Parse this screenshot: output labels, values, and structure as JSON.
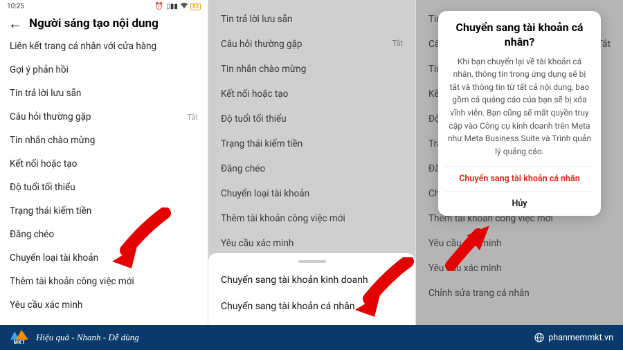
{
  "status": {
    "time": "10:25",
    "clock_icon": "⏰",
    "signal_icon": "▯▮▮",
    "battery": "83"
  },
  "panel1": {
    "title": "Người sáng tạo nội dung",
    "items": [
      {
        "label": "Liên kết trang cá nhân với cửa hàng",
        "badge": ""
      },
      {
        "label": "Gợi ý phản hồi",
        "badge": ""
      },
      {
        "label": "Tin trả lời lưu sẵn",
        "badge": ""
      },
      {
        "label": "Câu hỏi thường gặp",
        "badge": "Tắt"
      },
      {
        "label": "Tin nhắn chào mừng",
        "badge": ""
      },
      {
        "label": "Kết nối hoặc tạo",
        "badge": ""
      },
      {
        "label": "Độ tuổi tối thiểu",
        "badge": ""
      },
      {
        "label": "Trạng thái kiếm tiền",
        "badge": ""
      },
      {
        "label": "Đăng chéo",
        "badge": ""
      },
      {
        "label": "Chuyển loại tài khoản",
        "badge": ""
      },
      {
        "label": "Thêm tài khoản công việc mới",
        "badge": ""
      },
      {
        "label": "Yêu cầu xác minh",
        "badge": ""
      }
    ]
  },
  "panel2": {
    "items": [
      {
        "label": "Tin trả lời lưu sẵn",
        "badge": ""
      },
      {
        "label": "Câu hỏi thường gặp",
        "badge": "Tắt"
      },
      {
        "label": "Tin nhắn chào mừng",
        "badge": ""
      },
      {
        "label": "Kết nối hoặc tạo",
        "badge": ""
      },
      {
        "label": "Độ tuổi tối thiểu",
        "badge": ""
      },
      {
        "label": "Trạng thái kiếm tiền",
        "badge": ""
      },
      {
        "label": "Đăng chéo",
        "badge": ""
      },
      {
        "label": "Chuyển loại tài khoản",
        "badge": ""
      },
      {
        "label": "Thêm tài khoản công việc mới",
        "badge": ""
      },
      {
        "label": "Yêu cầu xác minh",
        "badge": ""
      }
    ],
    "sheet": {
      "options": [
        "Chuyển sang tài khoản kinh doanh",
        "Chuyển sang tài khoản cá nhân"
      ]
    }
  },
  "panel3": {
    "items": [
      {
        "label": "Tin trả lời lưu sẵn",
        "badge": ""
      },
      {
        "label": "Câu hỏi thường gặp",
        "badge": "Tắt"
      },
      {
        "label": "Tin nhắn chào mừng",
        "badge": ""
      },
      {
        "label": "Kết nối hoặc tạo",
        "badge": ""
      },
      {
        "label": "Độ tuổi tối thiểu",
        "badge": ""
      },
      {
        "label": "Trạng thái kiếm tiền",
        "badge": ""
      },
      {
        "label": "Đăng chéo",
        "badge": ""
      },
      {
        "label": "Chuyển loại tài khoản",
        "badge": ""
      },
      {
        "label": "Thêm tài khoản công việc mới",
        "badge": ""
      },
      {
        "label": "Yêu cầu xác minh",
        "badge": ""
      },
      {
        "label": "Yêu cầu xác minh",
        "badge": ""
      },
      {
        "label": "Chỉnh sửa trang cá nhân",
        "badge": ""
      }
    ],
    "dialog": {
      "title": "Chuyển sang tài khoản cá nhân?",
      "body": "Khi bạn chuyển lại về tài khoản cá nhân, thông tin trong ứng dụng sẽ bị tắt và thông tin từ tất cả nội dung, bao gồm cả quảng cáo của bạn sẽ bị xóa vĩnh viễn. Bạn cũng sẽ mất quyền truy cập vào Công cụ kinh doanh trên Meta như Meta Business Suite và Trình quản lý quảng cáo.",
      "confirm": "Chuyển sang tài khoản cá nhân",
      "cancel": "Hủy"
    }
  },
  "footer": {
    "logo_text": "MKT",
    "tagline": "Hiệu quả - Nhanh - Dễ dùng",
    "site": "phanmemmkt.vn"
  }
}
